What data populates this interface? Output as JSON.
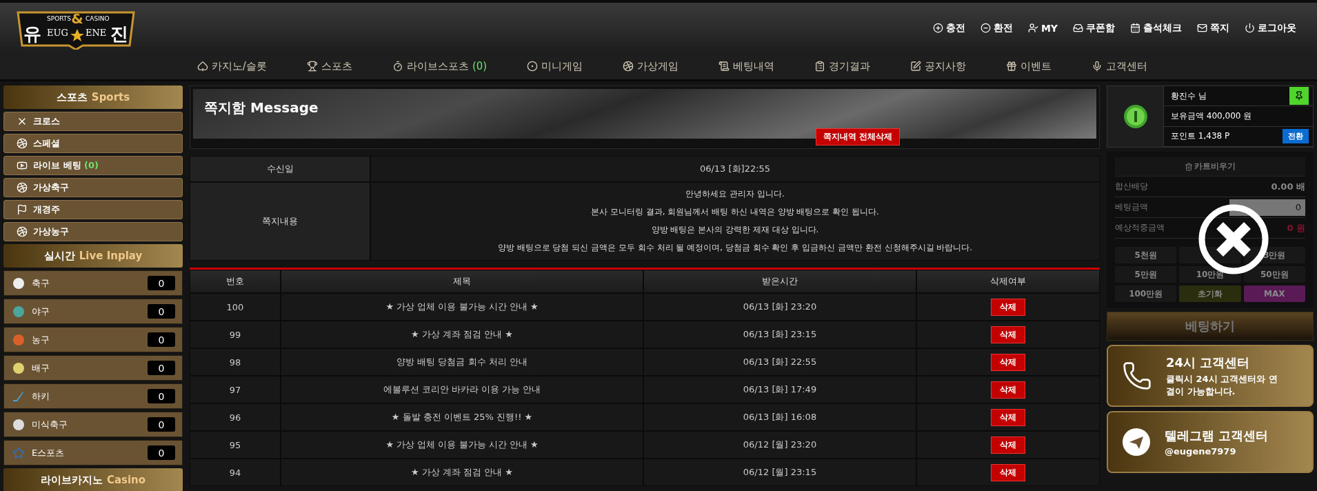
{
  "logo": {
    "top_left": "SPORTS",
    "amp": "&",
    "top_right": "CASINO",
    "left": "유",
    "mid_left": "EUG",
    "mid_right": "ENE",
    "right": "진"
  },
  "top_links": [
    {
      "kind": "plus",
      "label": "충전"
    },
    {
      "kind": "minus",
      "label": "환전"
    },
    {
      "kind": "user",
      "label": "MY"
    },
    {
      "kind": "box",
      "label": "쿠폰함"
    },
    {
      "kind": "calendar",
      "label": "출석체크"
    },
    {
      "kind": "mail",
      "label": "쪽지"
    },
    {
      "kind": "power",
      "label": "로그아웃"
    }
  ],
  "nav": [
    {
      "kind": "cards",
      "label": "카지노/슬롯"
    },
    {
      "kind": "trophy",
      "label": "스포츠"
    },
    {
      "kind": "timer",
      "label": "라이브스포츠",
      "count": "(0)"
    },
    {
      "kind": "ball",
      "label": "미니게임"
    },
    {
      "kind": "soccer",
      "label": "가상게임"
    },
    {
      "kind": "list",
      "label": "베팅내역"
    },
    {
      "kind": "clipboard",
      "label": "경기결과"
    },
    {
      "kind": "edit",
      "label": "공지사항"
    },
    {
      "kind": "gift",
      "label": "이벤트"
    },
    {
      "kind": "mic",
      "label": "고객센터"
    }
  ],
  "sidebar": {
    "sports_title": {
      "ko": "스포츠",
      "en": "Sports"
    },
    "sports_items": [
      {
        "kind": "cross",
        "label": "크로스"
      },
      {
        "kind": "basketball",
        "label": "스페셜"
      },
      {
        "kind": "video",
        "label": "라이브 베팅",
        "count": "(0)"
      },
      {
        "kind": "soccer",
        "label": "가상축구"
      },
      {
        "kind": "flag",
        "label": "개경주"
      },
      {
        "kind": "basketball",
        "label": "가상농구"
      }
    ],
    "live_title": {
      "ko": "실시간",
      "en": "Live Inplay"
    },
    "live_items": [
      {
        "kind": "soccer",
        "label": "축구",
        "count": "0"
      },
      {
        "kind": "baseball",
        "label": "야구",
        "count": "0"
      },
      {
        "kind": "basketball",
        "label": "농구",
        "count": "0"
      },
      {
        "kind": "volleyball",
        "label": "배구",
        "count": "0"
      },
      {
        "kind": "hockey",
        "label": "하키",
        "count": "0"
      },
      {
        "kind": "football",
        "label": "미식축구",
        "count": "0"
      },
      {
        "kind": "esports",
        "label": "E스포츠",
        "count": "0"
      }
    ],
    "casino_title": {
      "ko": "라이브카지노",
      "en": "Casino"
    }
  },
  "main": {
    "title": "쪽지함 Message",
    "delete_all": "쪽지내역 전체삭제",
    "detail": {
      "date_label": "수신일",
      "date": "06/13 [화]22:55",
      "content_label": "쪽지내용",
      "lines": [
        "안녕하세요 관리자 입니다.",
        "본사 모니터링 결과, 회원님께서 배팅 하신 내역은 양방 배팅으로 확인 됩니다.",
        "양방 배팅은 본사의 강력한 제재 대상 입니다.",
        "양방 배팅으로 당첨 되신 금액은 모두 회수 처리 될 예정이며, 당첨금 회수 확인 후 입금하신 금액만 환전 신청해주시길 바랍니다."
      ]
    },
    "list": {
      "columns": [
        "번호",
        "제목",
        "받은시간",
        "삭제여부"
      ],
      "rows": [
        {
          "no": "100",
          "subject": "★ 가상 업체 이용 불가능 시간 안내 ★",
          "time": "06/13 [화] 23:20",
          "action": "삭제"
        },
        {
          "no": "99",
          "subject": "★ 가상 계좌 점검 안내 ★",
          "time": "06/13 [화] 23:15",
          "action": "삭제"
        },
        {
          "no": "98",
          "subject": "양방 배팅 당첨금 회수 처리 안내",
          "time": "06/13 [화] 22:55",
          "action": "삭제"
        },
        {
          "no": "97",
          "subject": "에볼루션 코리안 바카라 이용 가능 안내",
          "time": "06/13 [화] 17:49",
          "action": "삭제"
        },
        {
          "no": "96",
          "subject": "★ 돌발 충전 이벤트 25% 진행!! ★",
          "time": "06/13 [화] 16:08",
          "action": "삭제"
        },
        {
          "no": "95",
          "subject": "★ 가상 업체 이용 불가능 시간 안내 ★",
          "time": "06/12 [월] 23:20",
          "action": "삭제"
        },
        {
          "no": "94",
          "subject": "★ 가상 계좌 점검 안내 ★",
          "time": "06/12 [월] 23:15",
          "action": "삭제"
        }
      ]
    }
  },
  "user": {
    "name": "황진수 님",
    "balance": "보유금액 400,000 원",
    "points": "포인트 1,438 P",
    "convert": "전환"
  },
  "cart": {
    "clear": "카트비우기",
    "rows": [
      {
        "kind": "text",
        "label": "합산배당",
        "value": "0.00 배"
      },
      {
        "kind": "input",
        "label": "베팅금액",
        "value": "0"
      },
      {
        "kind": "warn",
        "label": "예상적중금액",
        "value": "0 원"
      }
    ],
    "amounts": [
      {
        "kind": "amount",
        "label": "5천원"
      },
      {
        "kind": "amount"
      },
      {
        "kind": "amount",
        "label": "3만원"
      },
      {
        "kind": "amount",
        "label": "5만원"
      },
      {
        "kind": "amount",
        "label": "10만원"
      },
      {
        "kind": "amount",
        "label": "50만원"
      },
      {
        "kind": "amount",
        "label": "100만원"
      },
      {
        "kind": "reset",
        "label": "초기화"
      },
      {
        "kind": "max",
        "label": "MAX"
      }
    ],
    "bet": "베팅하기"
  },
  "support": [
    {
      "kind": "phone",
      "title": "24시 고객센터",
      "text": "클릭시 24시 고객센터와 연결이 가능합니다."
    },
    {
      "kind": "telegram",
      "title": "텔레그램 고객센터",
      "text": "@eugene7979"
    }
  ]
}
